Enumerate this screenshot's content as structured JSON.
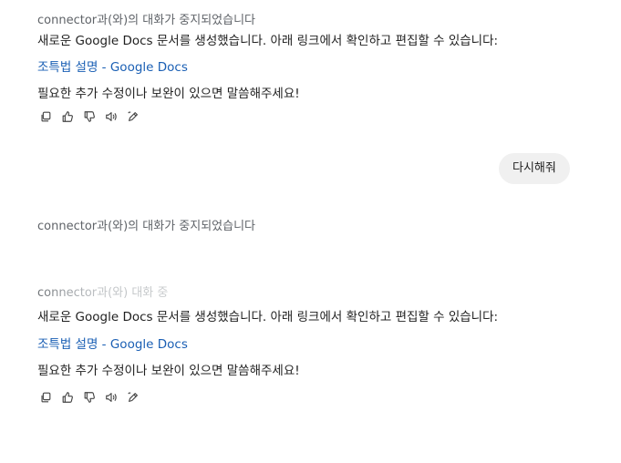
{
  "messages": [
    {
      "status": "connector과(와)의 대화가 중지되었습니다",
      "text": "새로운 Google Docs 문서를 생성했습니다. 아래 링크에서 확인하고 편집할 수 있습니다:",
      "link": "조특법 설명 - Google Docs",
      "followup": "필요한 추가 수정이나 보완이 있으면 말씀해주세요!"
    },
    {
      "user": "다시해줘"
    },
    {
      "status": "connector과(와)의 대화가 중지되었습니다"
    },
    {
      "status": "connector과(와) 대화 중",
      "text": "새로운 Google Docs 문서를 생성했습니다. 아래 링크에서 확인하고 편집할 수 있습니다:",
      "link": "조특법 설명 - Google Docs",
      "followup": "필요한 추가 수정이나 보완이 있으면 말씀해주세요!"
    }
  ],
  "actions": {
    "icons": [
      "copy-icon",
      "thumbs-up-icon",
      "thumbs-down-icon",
      "speaker-icon",
      "edit-icon"
    ]
  }
}
